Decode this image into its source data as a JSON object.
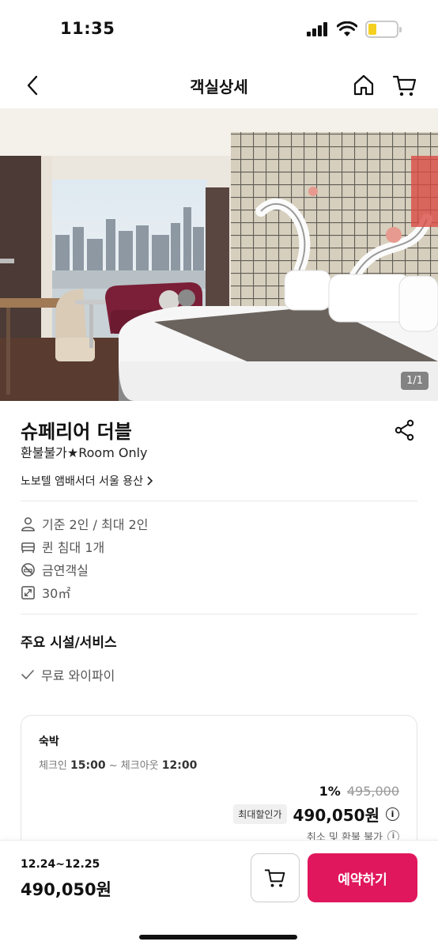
{
  "status_bar": {
    "time": "11:35",
    "battery_level": 0.3,
    "battery_color": "#f5d020"
  },
  "header": {
    "title": "객실상세",
    "icons": [
      "chevron-left-icon",
      "home-icon",
      "cart-icon"
    ]
  },
  "gallery": {
    "counter": "1/1"
  },
  "room": {
    "name": "슈페리어 더블",
    "subtitle": "환불불가★Room Only",
    "hotel_link": "노보텔 앰배서더 서울 용산",
    "specs": [
      {
        "icon": "person-icon",
        "text": "기준 2인 / 최대 2인"
      },
      {
        "icon": "bed-icon",
        "text": "퀸 침대 1개"
      },
      {
        "icon": "no-smoking-icon",
        "text": "금연객실"
      },
      {
        "icon": "area-icon",
        "text": "30㎡"
      }
    ]
  },
  "amenities": {
    "title": "주요 시설/서비스",
    "items": [
      {
        "icon": "check-icon",
        "text": "무료 와이파이"
      }
    ]
  },
  "rate": {
    "type": "숙박",
    "checkin_label": "체크인",
    "checkin_time": "15:00",
    "separator": "~",
    "checkout_label": "체크아웃",
    "checkout_time": "12:00",
    "discount_percent": "1%",
    "original_price": "495,000",
    "max_discount_label": "최대할인가",
    "sale_price": "490,050원",
    "cancel_policy": "취소 및 환불 불가"
  },
  "bottom_bar": {
    "date_range": "12.24~12.25",
    "total_price": "490,050원",
    "book_label": "예약하기"
  },
  "colors": {
    "accent": "#e0175c"
  }
}
